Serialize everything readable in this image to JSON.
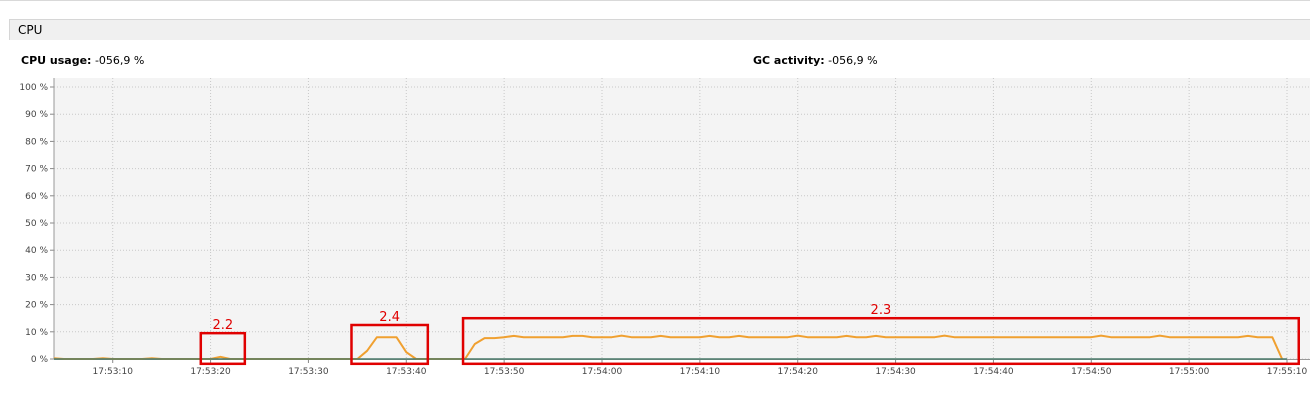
{
  "panel": {
    "title": "CPU"
  },
  "stats": {
    "cpu_usage_label": "CPU usage:",
    "cpu_usage_value": "-056,9 %",
    "gc_activity_label": "GC activity:",
    "gc_activity_value": "-056,9 %"
  },
  "colors": {
    "cpu_line": "#f0a030",
    "gc_line": "#4a7a6a",
    "annotation": "#e00000",
    "plot_bg": "#f4f4f4",
    "grid": "#c8c8c8"
  },
  "chart_data": {
    "type": "line",
    "ylim": [
      0,
      100
    ],
    "y_ticks": [
      "0 %",
      "10 %",
      "20 %",
      "30 %",
      "40 %",
      "50 %",
      "60 %",
      "70 %",
      "80 %",
      "90 %",
      "100 %"
    ],
    "x_range_seconds": [
      0,
      126
    ],
    "x_ticks": [
      {
        "t": 6,
        "label": "17:53:10"
      },
      {
        "t": 16,
        "label": "17:53:20"
      },
      {
        "t": 26,
        "label": "17:53:30"
      },
      {
        "t": 36,
        "label": "17:53:40"
      },
      {
        "t": 46,
        "label": "17:53:50"
      },
      {
        "t": 56,
        "label": "17:54:00"
      },
      {
        "t": 66,
        "label": "17:54:10"
      },
      {
        "t": 76,
        "label": "17:54:20"
      },
      {
        "t": 86,
        "label": "17:54:30"
      },
      {
        "t": 96,
        "label": "17:54:40"
      },
      {
        "t": 106,
        "label": "17:54:50"
      },
      {
        "t": 116,
        "label": "17:55:00"
      },
      {
        "t": 126,
        "label": "17:55:10"
      }
    ],
    "series": [
      {
        "key": "cpu",
        "points": [
          [
            0,
            0.3
          ],
          [
            1,
            0
          ],
          [
            4,
            0
          ],
          [
            5,
            0.3
          ],
          [
            6,
            0
          ],
          [
            9,
            0
          ],
          [
            10,
            0.3
          ],
          [
            11,
            0
          ],
          [
            16,
            0
          ],
          [
            17,
            0.8
          ],
          [
            18,
            0
          ],
          [
            30,
            0
          ],
          [
            31,
            0
          ],
          [
            32,
            3
          ],
          [
            33,
            8
          ],
          [
            34,
            8
          ],
          [
            35,
            8
          ],
          [
            36,
            2.5
          ],
          [
            37,
            0
          ],
          [
            42,
            0
          ],
          [
            43,
            5.5
          ],
          [
            44,
            7.7
          ],
          [
            45,
            7.7
          ],
          [
            46,
            8
          ],
          [
            47,
            8.5
          ],
          [
            48,
            8
          ],
          [
            52,
            8
          ],
          [
            53,
            8.5
          ],
          [
            54,
            8.5
          ],
          [
            55,
            8
          ],
          [
            57,
            8
          ],
          [
            58,
            8.6
          ],
          [
            59,
            8
          ],
          [
            61,
            8
          ],
          [
            62,
            8.5
          ],
          [
            63,
            8
          ],
          [
            66,
            8
          ],
          [
            67,
            8.5
          ],
          [
            68,
            8
          ],
          [
            69,
            8
          ],
          [
            70,
            8.5
          ],
          [
            71,
            8
          ],
          [
            75,
            8
          ],
          [
            76,
            8.6
          ],
          [
            77,
            8
          ],
          [
            80,
            8
          ],
          [
            81,
            8.5
          ],
          [
            82,
            8
          ],
          [
            83,
            8
          ],
          [
            84,
            8.5
          ],
          [
            85,
            8
          ],
          [
            90,
            8
          ],
          [
            91,
            8.6
          ],
          [
            92,
            8
          ],
          [
            98,
            8
          ],
          [
            99,
            8
          ],
          [
            106,
            8
          ],
          [
            107,
            8.6
          ],
          [
            108,
            8
          ],
          [
            112,
            8
          ],
          [
            113,
            8.6
          ],
          [
            114,
            8
          ],
          [
            121,
            8
          ],
          [
            122,
            8.5
          ],
          [
            123,
            8
          ],
          [
            124.5,
            8
          ],
          [
            125.5,
            0
          ]
        ]
      },
      {
        "key": "gc",
        "points": [
          [
            0,
            0
          ],
          [
            126,
            0
          ]
        ]
      }
    ]
  },
  "annotations": [
    {
      "label": "2.2",
      "t0": 15,
      "t1": 19.5,
      "y0": -0.3,
      "y1": 9.5
    },
    {
      "label": "2.4",
      "t0": 30.4,
      "t1": 38.2,
      "y0": -0.3,
      "y1": 12.5
    },
    {
      "label": "2.3",
      "t0": 41.8,
      "t1": 127.2,
      "y0": -0.3,
      "y1": 15
    }
  ]
}
